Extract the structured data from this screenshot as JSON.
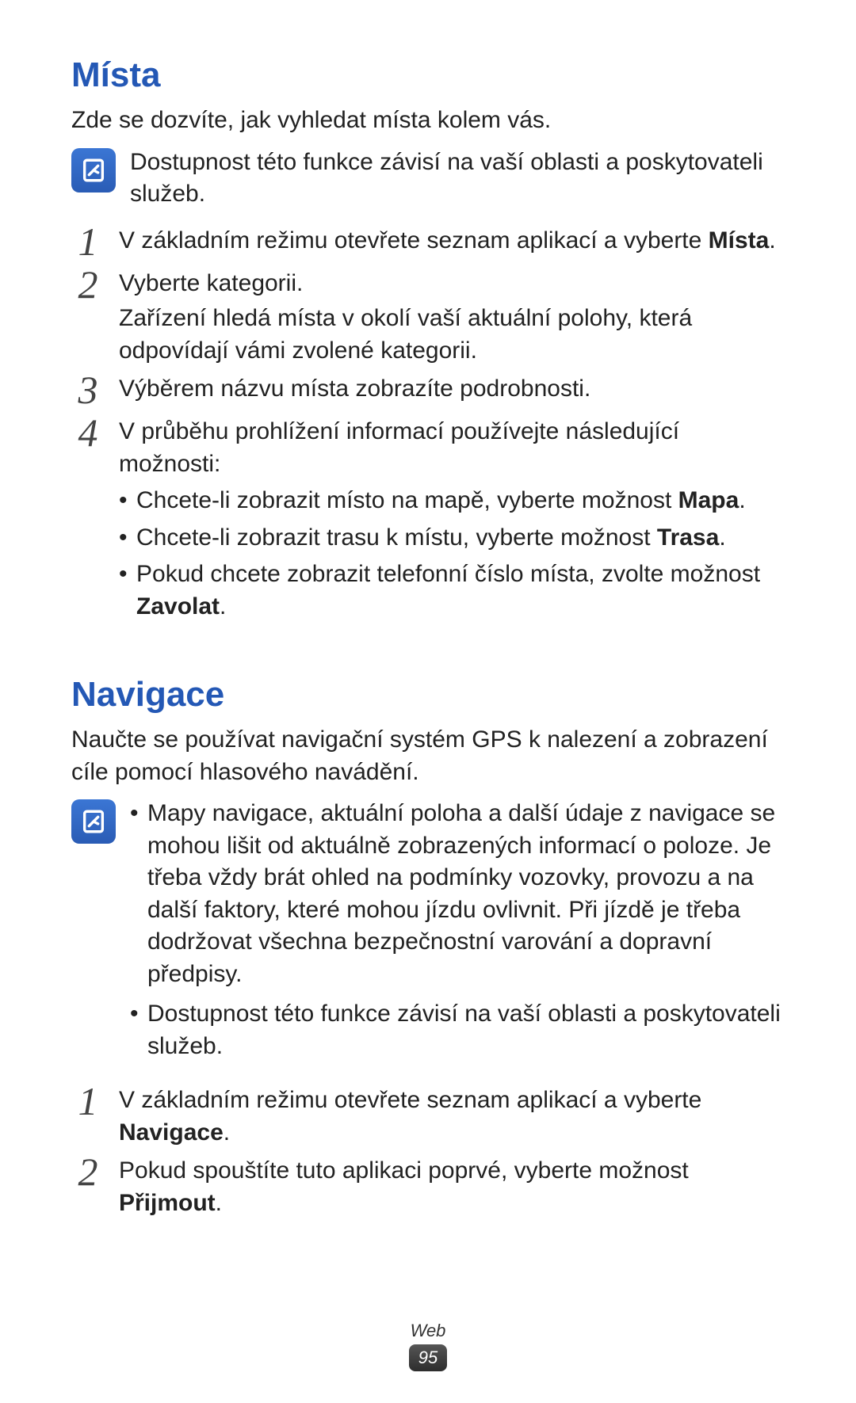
{
  "section1": {
    "heading": "Místa",
    "intro": "Zde se dozvíte, jak vyhledat místa kolem vás.",
    "note": "Dostupnost této funkce závisí na vaší oblasti a poskytovateli služeb.",
    "step1": {
      "num": "1",
      "pre": "V základním režimu otevřete seznam aplikací a vyberte ",
      "bold": "Místa",
      "post": "."
    },
    "step2": {
      "num": "2",
      "line1": "Vyberte kategorii.",
      "line2": "Zařízení hledá místa v okolí vaší aktuální polohy, která odpovídají vámi zvolené kategorii."
    },
    "step3": {
      "num": "3",
      "text": "Výběrem názvu místa zobrazíte podrobnosti."
    },
    "step4": {
      "num": "4",
      "lead": "V průběhu prohlížení informací používejte následující možnosti:",
      "b1": {
        "pre": "Chcete-li zobrazit místo na mapě, vyberte možnost ",
        "bold": "Mapa",
        "post": "."
      },
      "b2": {
        "pre": "Chcete-li zobrazit trasu k místu, vyberte možnost ",
        "bold": "Trasa",
        "post": "."
      },
      "b3": {
        "pre": "Pokud chcete zobrazit telefonní číslo místa, zvolte možnost ",
        "bold": "Zavolat",
        "post": "."
      }
    }
  },
  "section2": {
    "heading": "Navigace",
    "intro": "Naučte se používat navigační systém GPS k nalezení a zobrazení cíle pomocí hlasového navádění.",
    "note_b1": "Mapy navigace, aktuální poloha a další údaje z navigace se mohou lišit od aktuálně zobrazených informací o poloze. Je třeba vždy brát ohled na podmínky vozovky, provozu a na další faktory, které mohou jízdu ovlivnit. Při jízdě je třeba dodržovat všechna bezpečnostní varování a dopravní předpisy.",
    "note_b2": "Dostupnost této funkce závisí na vaší oblasti a poskytovateli služeb.",
    "step1": {
      "num": "1",
      "pre": "V základním režimu otevřete seznam aplikací a vyberte ",
      "bold": "Navigace",
      "post": "."
    },
    "step2": {
      "num": "2",
      "pre": "Pokud spouštíte tuto aplikaci poprvé, vyberte možnost ",
      "bold": "Přijmout",
      "post": "."
    }
  },
  "footer": {
    "label": "Web",
    "page": "95"
  }
}
